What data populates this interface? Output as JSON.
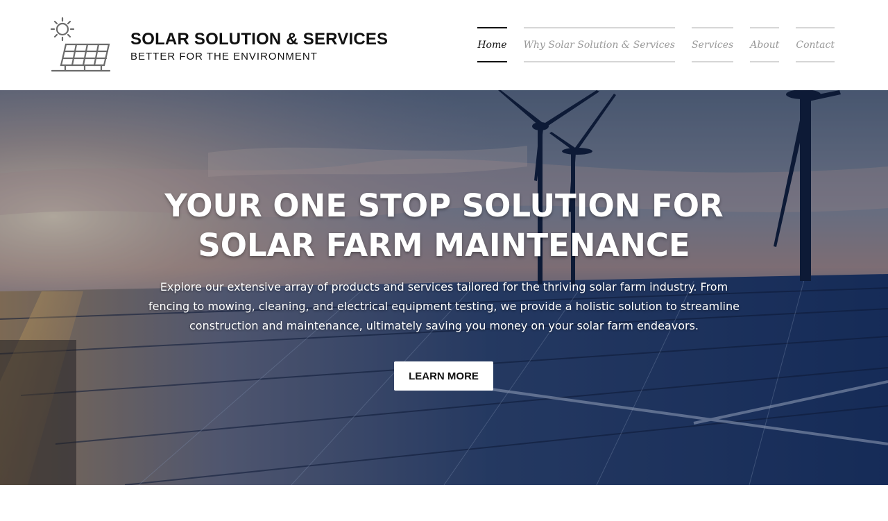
{
  "header": {
    "brand_title": "SOLAR SOLUTION & SERVICES",
    "brand_tagline": "BETTER FOR THE ENVIRONMENT",
    "logo_icon": "solar-panel-sun-icon"
  },
  "nav": {
    "items": [
      {
        "label": "Home",
        "active": true
      },
      {
        "label": "Why Solar Solution & Services",
        "active": false
      },
      {
        "label": "Services",
        "active": false
      },
      {
        "label": "About",
        "active": false
      },
      {
        "label": "Contact",
        "active": false
      }
    ]
  },
  "hero": {
    "title_line1": "YOUR ONE STOP SOLUTION FOR",
    "title_line2": "SOLAR FARM MAINTENANCE",
    "description": "Explore our extensive array of products and services tailored for the thriving solar farm industry. From fencing to mowing, cleaning, and electrical equipment testing, we provide a holistic solution to streamline construction and maintenance, ultimately saving you money on your solar farm endeavors.",
    "button_label": "LEARN MORE"
  },
  "colors": {
    "text_dark": "#111111",
    "nav_inactive": "#9a9a9a",
    "nav_border": "#d6d6d6",
    "button_bg": "#ffffff"
  }
}
